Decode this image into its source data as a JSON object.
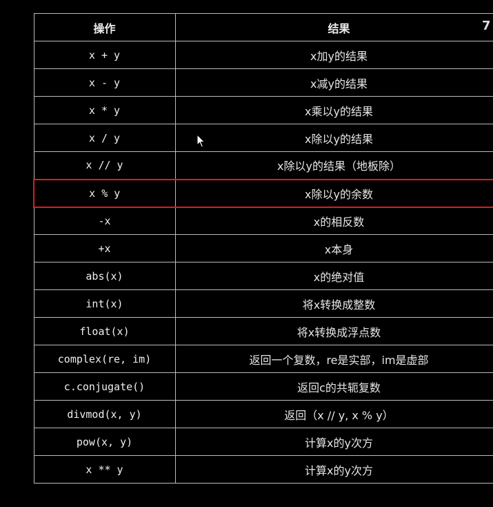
{
  "table": {
    "headers": {
      "operation": "操作",
      "result": "结果"
    },
    "rows": [
      {
        "op": "x + y",
        "result": "x加y的结果"
      },
      {
        "op": "x - y",
        "result": "x减y的结果"
      },
      {
        "op": "x * y",
        "result": "x乘以y的结果"
      },
      {
        "op": "x / y",
        "result": "x除以y的结果"
      },
      {
        "op": "x // y",
        "result": "x除以y的结果（地板除）"
      },
      {
        "op": "x % y",
        "result": "x除以y的余数",
        "highlighted": true
      },
      {
        "op": "-x",
        "result": "x的相反数"
      },
      {
        "op": "+x",
        "result": "x本身"
      },
      {
        "op": "abs(x)",
        "result": "x的绝对值"
      },
      {
        "op": "int(x)",
        "result": "将x转换成整数"
      },
      {
        "op": "float(x)",
        "result": "将x转换成浮点数"
      },
      {
        "op": "complex(re, im)",
        "result": "返回一个复数，re是实部，im是虚部"
      },
      {
        "op": "c.conjugate()",
        "result": "返回c的共轭复数"
      },
      {
        "op": "divmod(x, y)",
        "result": "返回（x // y, x % y）"
      },
      {
        "op": "pow(x, y)",
        "result": "计算x的y次方"
      },
      {
        "op": "x ** y",
        "result": "计算x的y次方"
      }
    ],
    "highlight_color": "#e11d1d"
  },
  "corner_mark": "7",
  "cursor": {
    "icon": "mouse-pointer-icon"
  }
}
